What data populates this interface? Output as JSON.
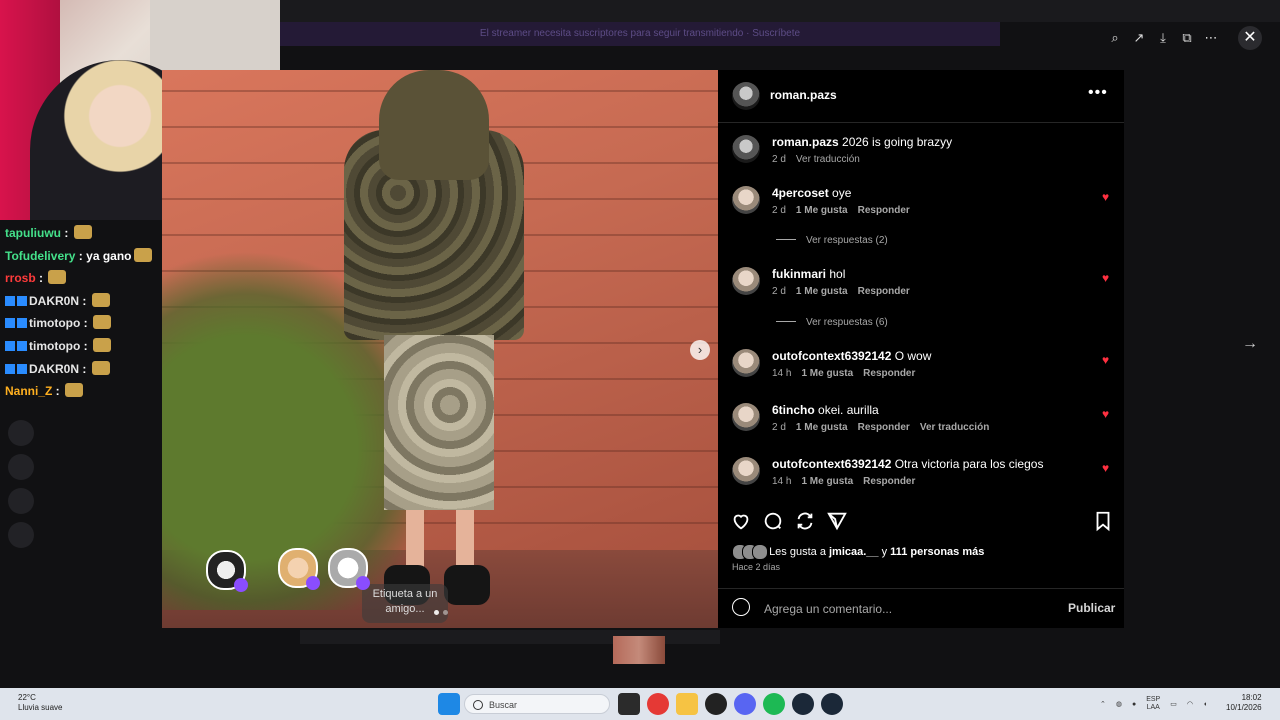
{
  "stream": {
    "banner_text": "El streamer necesita suscriptores para seguir transmitiendo · Suscríbete",
    "chat": [
      {
        "user": "tapuliuwu",
        "text": "",
        "color": "green",
        "badges": 0,
        "emote": true
      },
      {
        "user": "Tofudelivery",
        "text": "ya gano",
        "color": "green",
        "badges": 0,
        "emote": true
      },
      {
        "user": "rrosb",
        "text": "",
        "color": "red",
        "badges": 0,
        "emote": true
      },
      {
        "user": "DAKR0N",
        "text": "",
        "color": "blue",
        "badges": 2,
        "emote": true
      },
      {
        "user": "timotopo",
        "text": "",
        "color": "blue",
        "badges": 2,
        "emote": true
      },
      {
        "user": "timotopo",
        "text": "",
        "color": "blue",
        "badges": 2,
        "emote": true
      },
      {
        "user": "DAKR0N",
        "text": "",
        "color": "blue",
        "badges": 2,
        "emote": true
      },
      {
        "user": "Nanni_Z",
        "text": "",
        "color": "orange",
        "badges": 0,
        "emote": true
      }
    ]
  },
  "viewer": {
    "toolbar_icons": [
      "zoom-icon",
      "share-icon",
      "download-icon",
      "open-external-icon",
      "more-icon"
    ],
    "close_label": "✕",
    "next_label": "›",
    "outer_next_label": "→"
  },
  "post": {
    "author": "roman.pazs",
    "more_label": "•••",
    "tag_hint": "Etiqueta a un amigo...",
    "caption": {
      "user": "roman.pazs",
      "text": "2026 is going brazyy",
      "time": "2 d",
      "translate": "Ver traducción"
    },
    "comments": [
      {
        "user": "4percoset",
        "text": "oye",
        "time": "2 d",
        "likes": "1 Me gusta",
        "reply": "Responder",
        "translate": "",
        "replies": "Ver respuestas (2)"
      },
      {
        "user": "fukinmari",
        "text": "hol",
        "time": "2 d",
        "likes": "1 Me gusta",
        "reply": "Responder",
        "translate": "",
        "replies": "Ver respuestas (6)"
      },
      {
        "user": "outofcontext6392142",
        "text": "O wow",
        "time": "14 h",
        "likes": "1 Me gusta",
        "reply": "Responder",
        "translate": "",
        "replies": ""
      },
      {
        "user": "6tincho",
        "text": "okei. aurilla",
        "time": "2 d",
        "likes": "1 Me gusta",
        "reply": "Responder",
        "translate": "Ver traducción",
        "replies": ""
      },
      {
        "user": "outofcontext6392142",
        "text": "Otra victoria para los ciegos",
        "time": "14 h",
        "likes": "1 Me gusta",
        "reply": "Responder",
        "translate": "",
        "replies": ""
      }
    ],
    "likes_prefix": "Les gusta a ",
    "likes_user": "jmicaa.__",
    "likes_mid": " y ",
    "likes_count": "111 personas más",
    "ago": "Hace 2 días",
    "comment_placeholder": "Agrega un comentario...",
    "publish_label": "Publicar",
    "heart_color": "#ff3040"
  },
  "taskbar": {
    "temp": "22°C",
    "weather": "Lluvia suave",
    "search_placeholder": "Buscar",
    "lang": "ESP",
    "region": "LAA",
    "time": "18:02",
    "date": "10/1/2026",
    "apps": [
      "windows-icon",
      "files-icon",
      "chrome-icon",
      "folder-icon",
      "github-icon",
      "discord-icon",
      "spotify-icon",
      "steam-icon",
      "steam-icon"
    ]
  }
}
